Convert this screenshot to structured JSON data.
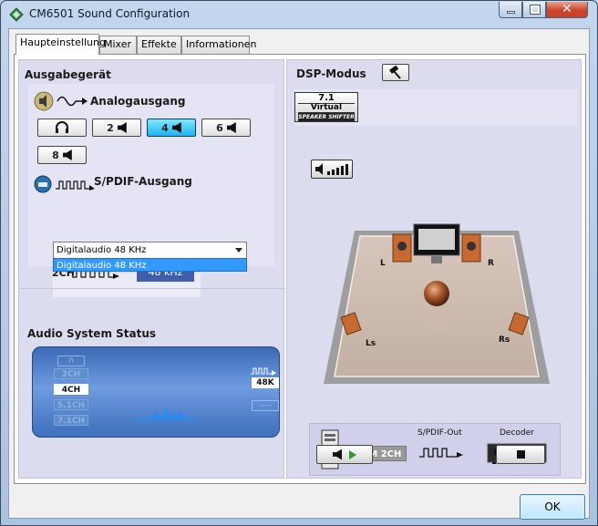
{
  "window": {
    "title": "CM6501 Sound Configuration"
  },
  "tabs": [
    {
      "label": "Haupteinstellung",
      "active": true
    },
    {
      "label": "Mixer"
    },
    {
      "label": "Effekte"
    },
    {
      "label": "Informationen"
    }
  ],
  "left": {
    "output_heading": "Ausgabegerät",
    "analog": {
      "label": "Analogausgang",
      "channels": [
        {
          "label": "2",
          "selected": false
        },
        {
          "label": "4",
          "selected": true
        },
        {
          "label": "6",
          "selected": false
        },
        {
          "label": "8",
          "selected": false
        }
      ]
    },
    "spdif": {
      "label": "S/PDIF-Ausgang",
      "selected_value": "Digitalaudio  48 KHz",
      "options": [
        "Digitalaudio  48 KHz"
      ],
      "channel_label": "2CH",
      "rate_label": "48 kHz"
    },
    "status_heading": "Audio System Status",
    "status": {
      "channels": [
        "2CH",
        "4CH",
        "5.1CH",
        "7.1CH"
      ],
      "active_channel": "4CH",
      "rate": "48K"
    }
  },
  "right": {
    "dsp_heading": "DSP-Modus",
    "virtual_badge": {
      "line1": "7.1",
      "line2": "Virtual",
      "line3": "SPEAKER SHIFTER"
    },
    "speaker_labels": {
      "left": "L",
      "right": "R",
      "left_surround": "Ls",
      "right_surround": "Rs"
    },
    "bottom": {
      "format_label": "PCM 2CH",
      "spdif_out_label": "S/PDIF-Out",
      "decoder_label": "Decoder"
    }
  },
  "footer": {
    "ok_label": "OK"
  },
  "colors": {
    "pane_bg": "#dcdcef",
    "selected_channel": "#1fb2ef",
    "status_panel": "#4a7fcc",
    "dropdown_highlight": "#3399ff",
    "khz_box": "#3f60a8"
  }
}
